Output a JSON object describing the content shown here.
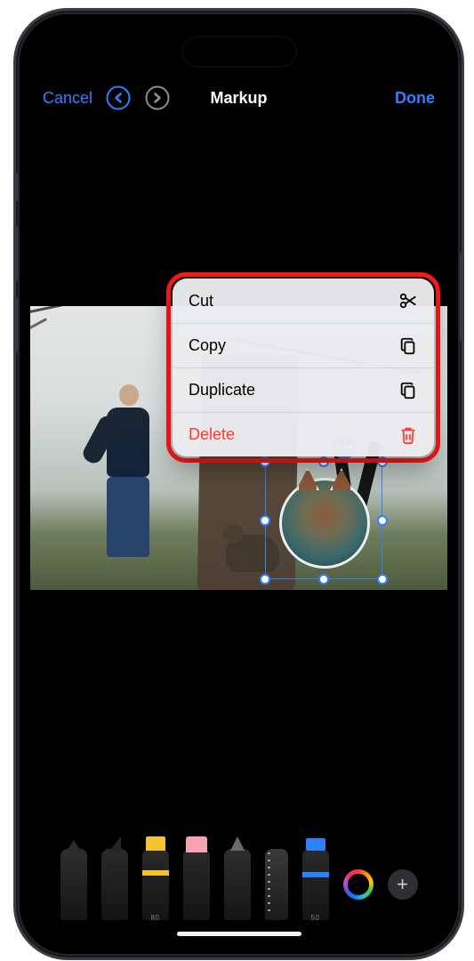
{
  "nav": {
    "cancel": "Cancel",
    "title": "Markup",
    "done": "Done"
  },
  "menu": {
    "cut": "Cut",
    "copy": "Copy",
    "duplicate": "Duplicate",
    "delete": "Delete"
  },
  "tools": {
    "highlighter_size": "80",
    "blue_pen_size": "50"
  },
  "colors": {
    "ios_blue": "#2f80ff",
    "ios_red": "#ff3b30"
  }
}
